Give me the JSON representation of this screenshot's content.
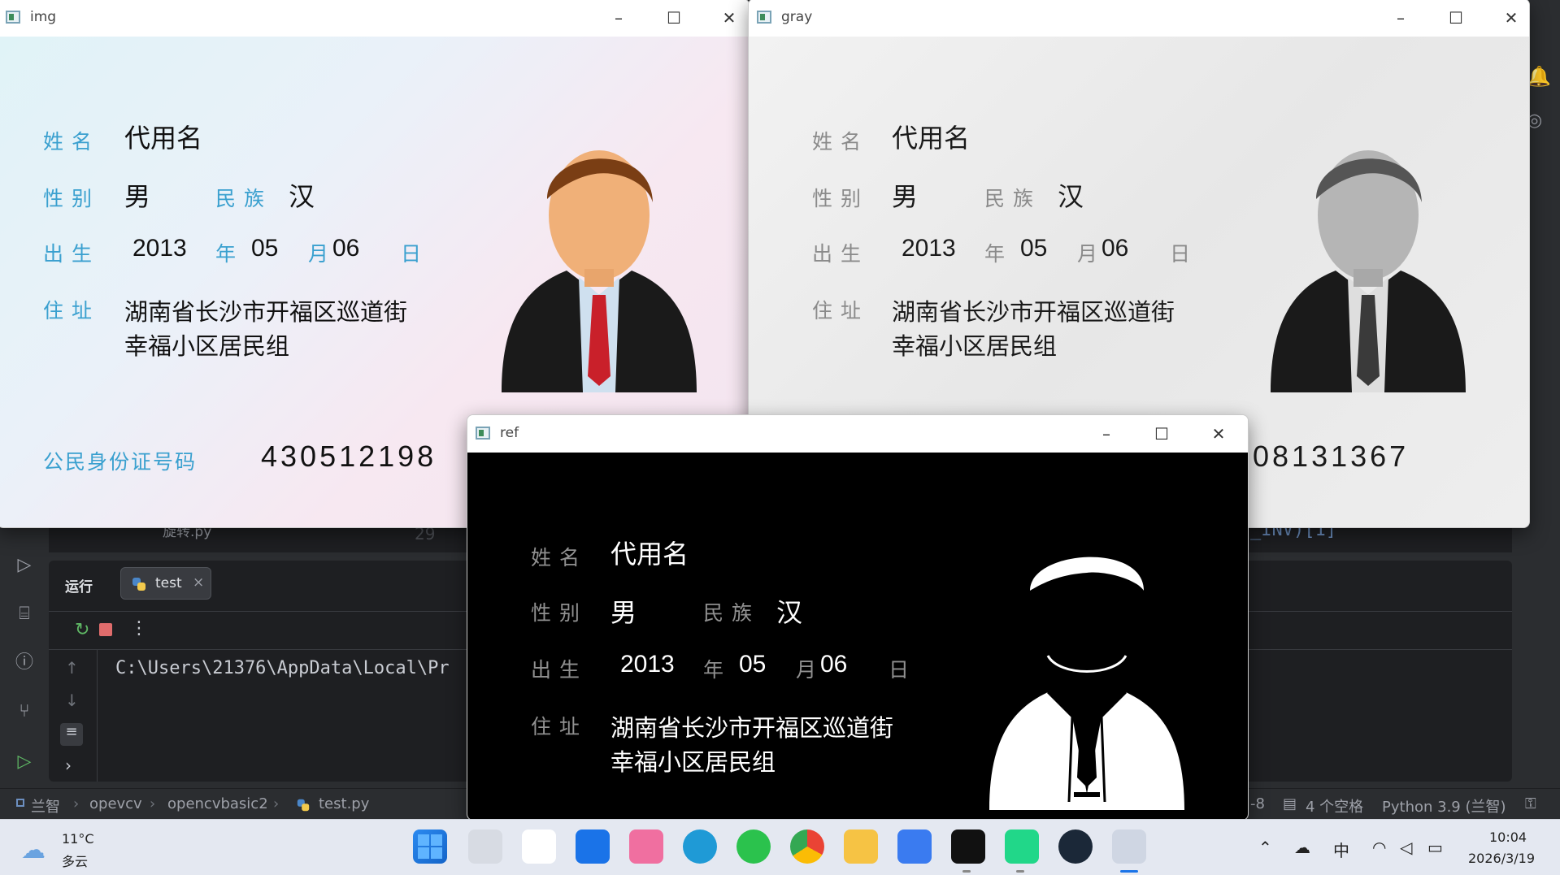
{
  "ide": {
    "run_label": "运行",
    "run_tab": "test",
    "console_line": "C:\\Users\\21376\\AppData\\Local\\Pr",
    "ghost_left_tab": "旋转.py",
    "ghost_line_num": "29",
    "ghost_right_text": "_INV)[1]",
    "breadcrumbs": [
      "兰智",
      "opevcv",
      "opencvbasic2",
      "test.py"
    ],
    "status_right": {
      "spaces": "4 个空格",
      "interpreter": "Python 3.9 (兰智)",
      "enc_fragment": "-8"
    }
  },
  "windows": {
    "img": {
      "title": "img"
    },
    "gray": {
      "title": "gray"
    },
    "ref": {
      "title": "ref"
    }
  },
  "card": {
    "name_label": "姓名",
    "name_value": "代用名",
    "gender_label": "性别",
    "gender_value": "男",
    "ethnicity_label": "民族",
    "ethnicity_value": "汉",
    "birth_label": "出生",
    "birth_year": "2013",
    "year_char": "年",
    "birth_month": "05",
    "month_char": "月",
    "birth_day": "06",
    "day_char": "日",
    "address_label": "住址",
    "address_line1": "湖南省长沙市开福区巡道街",
    "address_line2": "幸福小区居民组",
    "id_label": "公民身份证号码",
    "id_visible_left": "43051219​8",
    "id_visible_right": "08131367"
  },
  "ref_card": {
    "name_label": "姓名",
    "gender_label": "性别",
    "ethnicity_label": "民族",
    "birth_label": "出生",
    "year_char": "年",
    "month_char": "月",
    "day_char": "日",
    "address_label": "住址"
  },
  "taskbar": {
    "weather_temp": "11°C",
    "weather_desc": "多云",
    "time": "10:04",
    "date": "2026/3/19",
    "ime": "中"
  },
  "colors": {
    "ide_bg": "#2b2d30",
    "label_blue": "#3aa0cf",
    "taskbar_bg": "#e4e8f1"
  }
}
